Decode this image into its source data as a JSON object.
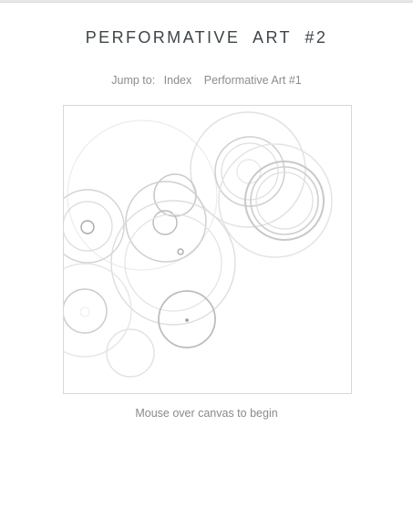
{
  "title": "PERFORMATIVE  ART  #2",
  "jump": {
    "label": "Jump to:",
    "links": [
      {
        "text": "Index"
      },
      {
        "text": "Performative Art #1"
      }
    ]
  },
  "canvas": {
    "status_text": "Mouse over canvas to begin"
  }
}
